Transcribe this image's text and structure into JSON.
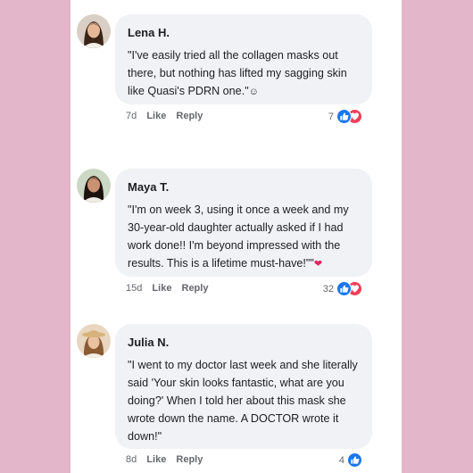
{
  "comments": [
    {
      "name": "Lena H.",
      "text": "\"I've easily tried all the collagen masks out there, but nothing has lifted my sagging skin like Quasi's PDRN one.\"",
      "emoji": "☺",
      "time": "7d",
      "like_label": "Like",
      "reply_label": "Reply",
      "count": "7",
      "reactions": [
        "like-icon",
        "heart-icon"
      ]
    },
    {
      "name": "Maya T.",
      "text": "\"I'm on week 3, using it once a week and my 30-year-old daughter actually asked if I had work done!! I'm beyond impressed with the results. This is a lifetime must-have!\"\"",
      "emoji": "❤",
      "time": "15d",
      "like_label": "Like",
      "reply_label": "Reply",
      "count": "32",
      "reactions": [
        "like-icon",
        "heart-icon"
      ]
    },
    {
      "name": "Julia N.",
      "text": "\"I went to my doctor last week and she literally said 'Your skin looks fantastic, what are you doing?' When I told her about this mask she wrote down the name. A DOCTOR wrote it down!\"",
      "emoji": "",
      "time": "8d",
      "like_label": "Like",
      "reply_label": "Reply",
      "count": "4",
      "reactions": [
        "like-icon"
      ]
    }
  ],
  "colors": {
    "background": "#e3b6c9",
    "like": "#1877f2",
    "heart": "#f33e58",
    "bubble": "#f0f2f5"
  }
}
